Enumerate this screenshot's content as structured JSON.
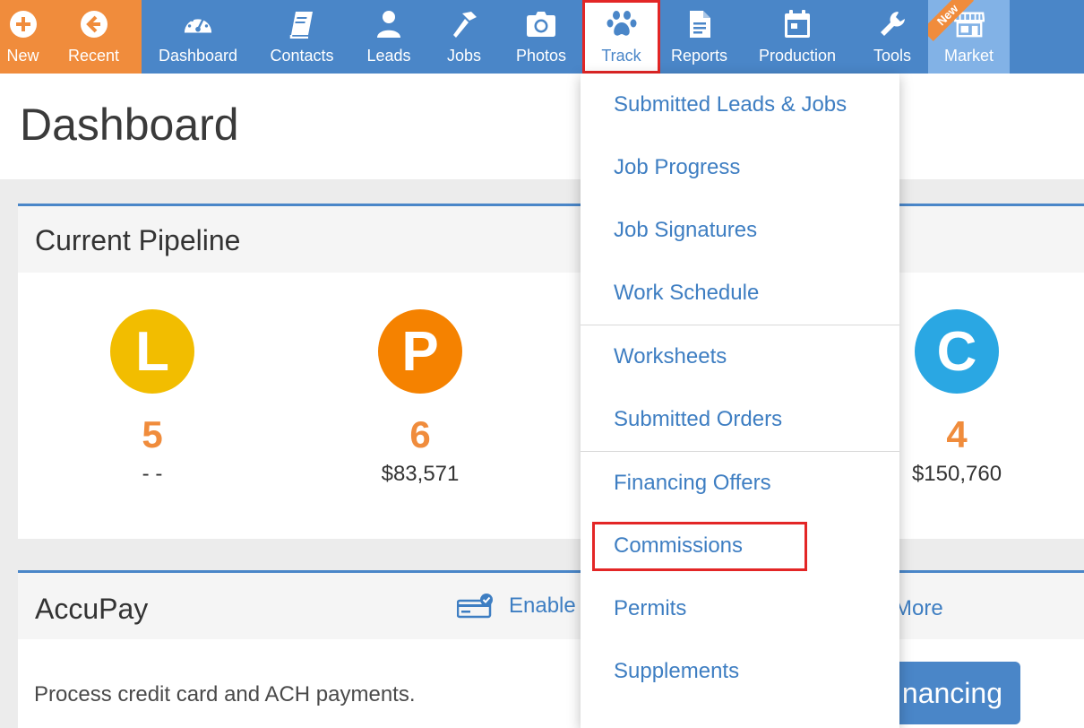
{
  "nav": {
    "items": [
      {
        "label": "New",
        "icon": "plus-circle-icon"
      },
      {
        "label": "Recent",
        "icon": "arrow-left-circle-icon"
      },
      {
        "label": "Dashboard",
        "icon": "speedometer-icon"
      },
      {
        "label": "Contacts",
        "icon": "book-icon"
      },
      {
        "label": "Leads",
        "icon": "person-icon"
      },
      {
        "label": "Jobs",
        "icon": "hammer-icon"
      },
      {
        "label": "Photos",
        "icon": "camera-icon"
      },
      {
        "label": "Track",
        "icon": "paw-icon"
      },
      {
        "label": "Reports",
        "icon": "document-icon"
      },
      {
        "label": "Production",
        "icon": "calendar-icon"
      },
      {
        "label": "Tools",
        "icon": "wrench-icon"
      },
      {
        "label": "Market",
        "icon": "storefront-icon",
        "badge": "New"
      }
    ],
    "active": "Track",
    "colors": {
      "bar": "#4a86c8",
      "orange": "#f08c3c",
      "market": "#82b2e6",
      "highlight": "#e32626"
    }
  },
  "page": {
    "title": "Dashboard"
  },
  "pipeline": {
    "title": "Current Pipeline",
    "stages": [
      {
        "letter": "L",
        "count": "5",
        "amount": "- -",
        "color": "#f2bd00"
      },
      {
        "letter": "P",
        "count": "6",
        "amount": "$83,571",
        "color": "#f58200"
      },
      {
        "letter": "C",
        "count": "4",
        "amount": "$150,760",
        "color": "#2aa7e3"
      }
    ]
  },
  "accupay": {
    "title": "AccuPay",
    "enable_label": "Enable",
    "more_label": "More",
    "description": "Process credit card and ACH payments.",
    "button_label": "nancing"
  },
  "track_menu": {
    "items": [
      "Submitted Leads & Jobs",
      "Job Progress",
      "Job Signatures",
      "Work Schedule",
      "Worksheets",
      "Submitted Orders",
      "Financing Offers",
      "Commissions",
      "Permits",
      "Supplements"
    ],
    "highlighted": "Commissions"
  }
}
